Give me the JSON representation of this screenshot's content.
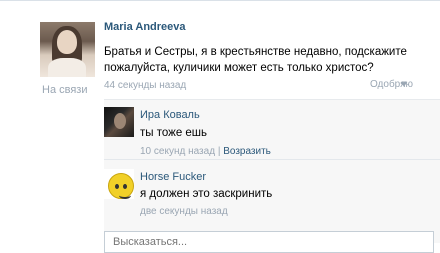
{
  "post": {
    "author": "Maria Andreeva",
    "status": "На связи",
    "text": "Братья и Сестры, я в крестьянстве недавно, подскажите пожалуйста, куличики может есть только христос?",
    "time": "44 секунды назад",
    "like_label": "Одобряю",
    "like_icon": "heart-icon"
  },
  "replies": [
    {
      "name": "Ира Коваль",
      "text": "ты тоже ешь",
      "time": "10 секунд назад",
      "separator": "|",
      "reply_label": "Возразить"
    },
    {
      "name": "Horse Fucker",
      "text": "я должен это заскринить",
      "time": "две секунды назад"
    }
  ],
  "comment": {
    "placeholder": "Высказаться..."
  }
}
